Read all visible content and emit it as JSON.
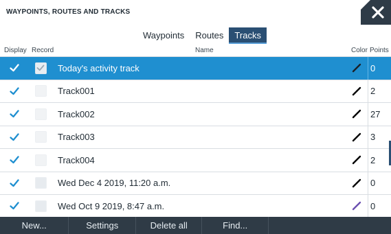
{
  "window": {
    "title": "WAYPOINTS, ROUTES AND TRACKS"
  },
  "tabs": [
    {
      "label": "Waypoints",
      "active": false
    },
    {
      "label": "Routes",
      "active": false
    },
    {
      "label": "Tracks",
      "active": true
    }
  ],
  "columns": {
    "display": "Display",
    "record": "Record",
    "name": "Name",
    "color": "Color",
    "points": "Points"
  },
  "tracks": [
    {
      "name": "Today's activity track",
      "points": "0",
      "display": true,
      "record": true,
      "color": "#1a2028",
      "selected": true
    },
    {
      "name": "Track001",
      "points": "2",
      "display": true,
      "record": false,
      "color": "#000000",
      "selected": false
    },
    {
      "name": "Track002",
      "points": "27",
      "display": true,
      "record": false,
      "color": "#000000",
      "selected": false
    },
    {
      "name": "Track003",
      "points": "3",
      "display": true,
      "record": false,
      "color": "#000000",
      "selected": false
    },
    {
      "name": "Track004",
      "points": "2",
      "display": true,
      "record": false,
      "color": "#000000",
      "selected": false
    },
    {
      "name": "Wed Dec 4 2019, 11:20 a.m.",
      "points": "0",
      "display": true,
      "record": false,
      "color": "#000000",
      "selected": false
    },
    {
      "name": "Wed Oct 9 2019, 8:47 a.m.",
      "points": "0",
      "display": true,
      "record": false,
      "color": "#6a4fb0",
      "selected": false
    }
  ],
  "bottom_bar": [
    {
      "label": "New..."
    },
    {
      "label": "Settings"
    },
    {
      "label": "Delete all"
    },
    {
      "label": "Find..."
    }
  ],
  "colors": {
    "accent_selected_row": "#1f8fd0",
    "active_tab": "#2a4f73",
    "toolbar": "#2f3b46"
  }
}
